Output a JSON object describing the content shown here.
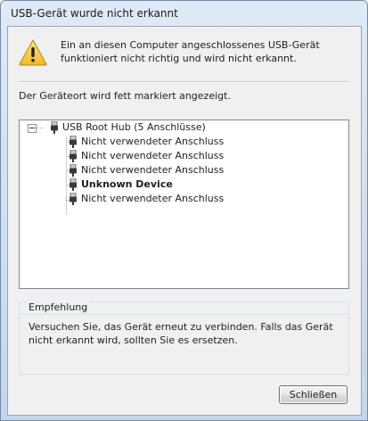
{
  "window": {
    "title": "USB-Gerät wurde nicht erkannt"
  },
  "warning": {
    "icon": "warning-icon",
    "message": "Ein an diesen Computer angeschlossenes USB-Gerät funktioniert nicht richtig und wird nicht erkannt."
  },
  "location_text": "Der Geräteort wird fett markiert angezeigt.",
  "tree": {
    "root": {
      "label": "USB Root Hub (5 Anschlüsse)",
      "icon": "usb-plug-icon",
      "expanded": true
    },
    "children": [
      {
        "label": "Nicht verwendeter Anschluss",
        "bold": false
      },
      {
        "label": "Nicht verwendeter Anschluss",
        "bold": false
      },
      {
        "label": "Nicht verwendeter Anschluss",
        "bold": false
      },
      {
        "label": "Unknown Device",
        "bold": true
      },
      {
        "label": "Nicht verwendeter Anschluss",
        "bold": false
      }
    ]
  },
  "recommendation": {
    "title": "Empfehlung",
    "text": "Versuchen Sie, das Gerät erneut zu verbinden. Falls das Gerät nicht erkannt wird, sollten Sie es ersetzen."
  },
  "buttons": {
    "close_label": "Schließen"
  }
}
